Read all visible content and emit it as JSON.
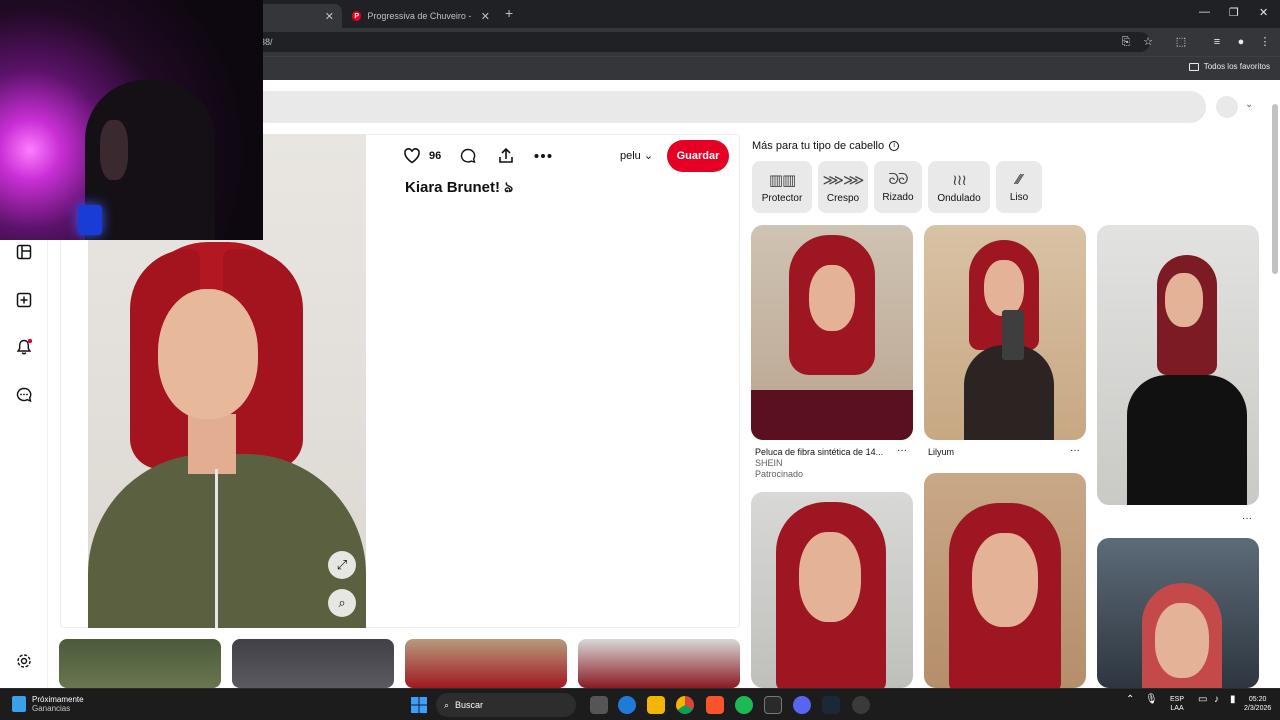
{
  "browser": {
    "tabs": [
      {
        "title": ""
      },
      {
        "title": "Progressiva de Chuveiro - Cabe"
      }
    ],
    "url": "38/",
    "bookmarks_label": "Todos los favoritos"
  },
  "pin": {
    "likes": "96",
    "board": "pelu",
    "save_label": "Guardar",
    "title": "Kiara Brunet! ঌ"
  },
  "related": {
    "heading": "Más para tu tipo de cabello",
    "chips": [
      {
        "label": "Protector",
        "icon": "protector-icon"
      },
      {
        "label": "Crespo",
        "icon": "crespo-icon"
      },
      {
        "label": "Rizado",
        "icon": "rizado-icon"
      },
      {
        "label": "Ondulado",
        "icon": "ondulado-icon"
      },
      {
        "label": "Liso",
        "icon": "liso-icon"
      }
    ],
    "pins": [
      {
        "caption": "Peluca de fibra sintética de 14...",
        "source": "SHEIN",
        "note": "Patrocinado"
      },
      {
        "caption": "Lilyum"
      }
    ]
  },
  "taskbar": {
    "weather_title": "Próximamente",
    "weather_sub": "Ganancias",
    "search_label": "Buscar",
    "lang_top": "ESP",
    "lang_bottom": "LAA",
    "time": "05:20",
    "date": "2/3/2026"
  },
  "colors": {
    "brand": "#e60023",
    "chip_bg": "#e9e9e9",
    "hair": "#a3141f"
  }
}
